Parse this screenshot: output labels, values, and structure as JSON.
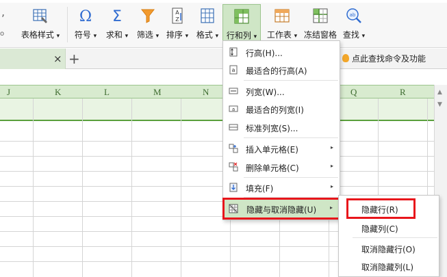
{
  "ribbon": {
    "buttons": [
      {
        "label": "表格样式",
        "icon": "table-style-icon"
      },
      {
        "label": "符号",
        "icon": "omega-icon"
      },
      {
        "label": "求和",
        "icon": "sigma-icon"
      },
      {
        "label": "筛选",
        "icon": "funnel-icon"
      },
      {
        "label": "排序",
        "icon": "sort-az-icon"
      },
      {
        "label": "格式",
        "icon": "format-grid-icon"
      },
      {
        "label": "行和列",
        "icon": "rows-columns-icon"
      },
      {
        "label": "工作表",
        "icon": "worksheet-icon"
      },
      {
        "label": "冻结窗格",
        "icon": "freeze-panes-icon"
      },
      {
        "label": "查找",
        "icon": "find-icon"
      }
    ],
    "dropdown_glyph": "▾"
  },
  "tabs": {
    "close_glyph": "×",
    "add_glyph": "+",
    "search_hint": "点此查找命令及功能"
  },
  "sheet": {
    "columns": [
      "J",
      "K",
      "L",
      "M",
      "N",
      "Q",
      "R"
    ]
  },
  "menu": {
    "items": [
      {
        "label": "行高(H)...",
        "icon": "row-height-icon",
        "has_submenu": false
      },
      {
        "label": "最适合的行高(A)",
        "icon": "autofit-row-height-icon",
        "has_submenu": false
      },
      {
        "label": "列宽(W)...",
        "icon": "column-width-icon",
        "has_submenu": false
      },
      {
        "label": "最适合的列宽(I)",
        "icon": "autofit-column-width-icon",
        "has_submenu": false
      },
      {
        "label": "标准列宽(S)...",
        "icon": "standard-column-width-icon",
        "has_submenu": false
      },
      {
        "label": "插入单元格(E)",
        "icon": "insert-cells-icon",
        "has_submenu": true
      },
      {
        "label": "删除单元格(C)",
        "icon": "delete-cells-icon",
        "has_submenu": true
      },
      {
        "label": "填充(F)",
        "icon": "fill-down-icon",
        "has_submenu": true
      },
      {
        "label": "隐藏与取消隐藏(U)",
        "icon": "hide-unhide-icon",
        "has_submenu": true
      }
    ],
    "submenu_arrow": "▸"
  },
  "submenu": {
    "items": [
      {
        "label": "隐藏行(R)"
      },
      {
        "label": "隐藏列(C)"
      },
      {
        "label": "取消隐藏行(O)"
      },
      {
        "label": "取消隐藏列(L)"
      }
    ]
  },
  "colors": {
    "accent_green": "#5aa03c",
    "highlight_bg": "#cfe6c6",
    "callout_red": "#e8151b"
  }
}
